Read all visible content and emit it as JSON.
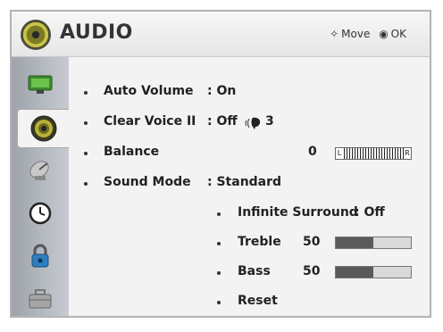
{
  "header": {
    "title": "AUDIO",
    "move_label": "Move",
    "ok_label": "OK"
  },
  "menu": {
    "auto_volume": {
      "label": "Auto Volume",
      "value": ": On"
    },
    "clear_voice": {
      "label": "Clear Voice II",
      "value": ": Off",
      "level": "3"
    },
    "balance": {
      "label": "Balance",
      "value": "0",
      "left": "L",
      "right": "R"
    },
    "sound_mode": {
      "label": "Sound Mode",
      "value": ": Standard"
    },
    "infinite_surround": {
      "label": "Infinite Surround",
      "value": ": Off"
    },
    "treble": {
      "label": "Treble",
      "value": "50",
      "level_fraction": 0.5
    },
    "bass": {
      "label": "Bass",
      "value": "50",
      "level_fraction": 0.5
    },
    "reset": {
      "label": "Reset"
    }
  },
  "sidebar": {
    "tabs": [
      "picture-icon",
      "audio-icon",
      "satellite-icon",
      "clock-icon",
      "lock-icon",
      "toolbox-icon"
    ],
    "active": "audio-icon"
  }
}
